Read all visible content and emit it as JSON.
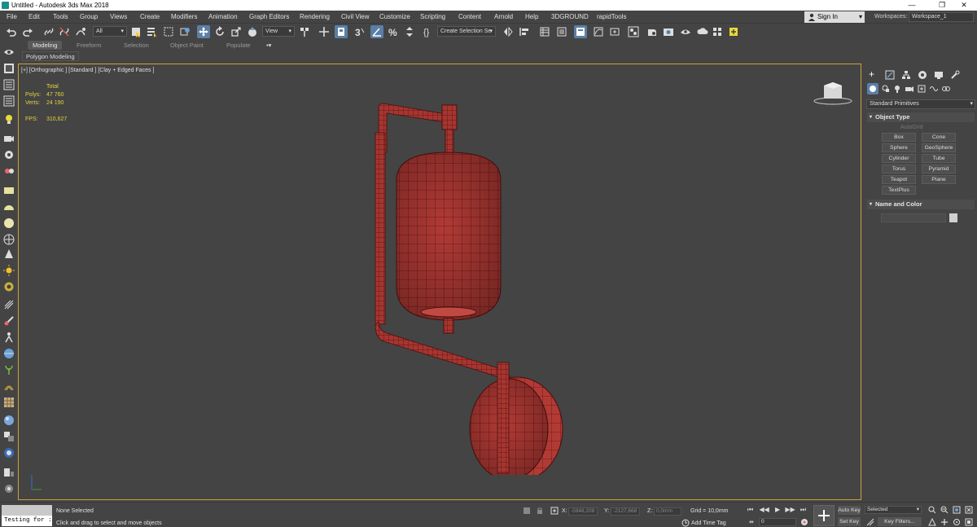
{
  "window": {
    "title": "Untitled - Autodesk 3ds Max 2018",
    "minimize": "—",
    "maximize": "❐",
    "close": "✕"
  },
  "menu": [
    "File",
    "Edit",
    "Tools",
    "Group",
    "Views",
    "Create",
    "Modifiers",
    "Animation",
    "Graph Editors",
    "Rendering",
    "Civil View",
    "Customize",
    "Scripting",
    "Content",
    "Arnold",
    "Help",
    "3DGROUND",
    "rapidTools"
  ],
  "account": {
    "sign_in": "Sign In",
    "workspaces_label": "Workspaces:",
    "workspace": "Workspace_1"
  },
  "toolbar": {
    "filter": "All",
    "ref_coord": "View",
    "selection_set": "Create Selection Se"
  },
  "ribbon": {
    "tabs": [
      "Modeling",
      "Freeform",
      "Selection",
      "Object Paint",
      "Populate"
    ],
    "active": "Modeling",
    "sub_label": "Polygon Modeling"
  },
  "viewport": {
    "label": "[+] [Orthographic ] [Standard ] [Clay + Edged Faces ]",
    "stats": {
      "total_label": "Total",
      "polys_label": "Polys:",
      "polys": "47 760",
      "verts_label": "Verts:",
      "verts": "24 190",
      "fps_label": "FPS:",
      "fps": "310,627"
    },
    "mesh_color": "#b23a35"
  },
  "command_panel": {
    "category": "Standard Primitives",
    "object_type_title": "Object Type",
    "autogrid": "AutoGrid",
    "buttons": [
      "Box",
      "Cone",
      "Sphere",
      "GeoSphere",
      "Cylinder",
      "Tube",
      "Torus",
      "Pyramid",
      "Teapot",
      "Plane",
      "TextPlus"
    ],
    "name_color_title": "Name and Color"
  },
  "status": {
    "maxscript": "Testing for :",
    "selection": "None Selected",
    "prompt": "Click and drag to select and move objects",
    "x_label": "X:",
    "x": "-5948,208",
    "y_label": "Y:",
    "y": "-2127,668",
    "z_label": "Z:",
    "z": "0,0mm",
    "grid": "Grid = 10,0mm",
    "add_time_tag": "Add Time Tag",
    "frame": "0",
    "auto_key": "Auto Key",
    "set_key": "Set Key",
    "selected": "Selected",
    "key_filters": "Key Filters..."
  },
  "colors": {
    "accent_blue": "#5b7fa6",
    "viewport_border": "#c9a23a",
    "stats_yellow": "#e5d23c"
  }
}
